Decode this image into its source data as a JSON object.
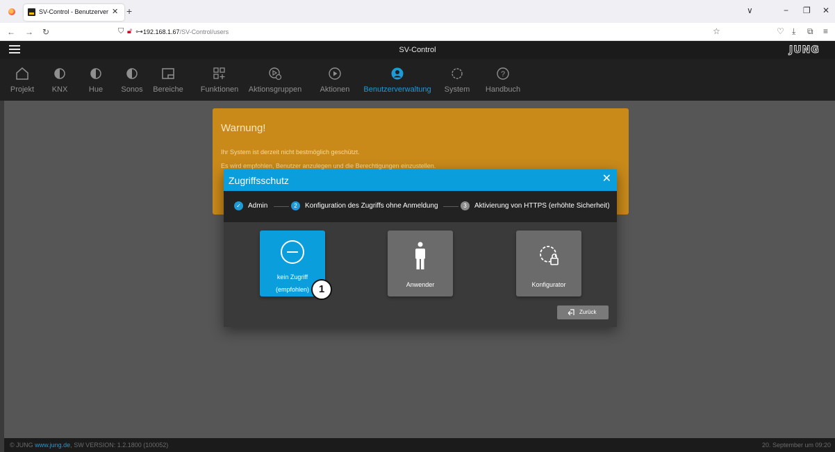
{
  "browser": {
    "tab_title": "SV-Control - Benutzerverwaltun",
    "tab_close": "✕",
    "new_tab": "+",
    "url_host": "192.168.1.67",
    "url_path": "/SV-Control/users",
    "window_controls": [
      "∨",
      "−",
      "❐",
      "✕"
    ]
  },
  "app": {
    "title": "SV-Control",
    "logo_text": "JUNG"
  },
  "nav": {
    "items": [
      {
        "label": "Projekt",
        "icon": "house-icon"
      },
      {
        "label": "KNX",
        "icon": "half-circle-icon"
      },
      {
        "label": "Hue",
        "icon": "half-circle-icon"
      },
      {
        "label": "Sonos",
        "icon": "half-circle-icon"
      },
      {
        "label": "Bereiche",
        "icon": "area-icon"
      },
      {
        "label": "Funktionen",
        "icon": "grid-plus-icon"
      },
      {
        "label": "Aktionsgruppen",
        "icon": "play-group-icon"
      },
      {
        "label": "Aktionen",
        "icon": "play-circle-icon"
      },
      {
        "label": "Benutzerverwaltung",
        "icon": "user-circle-icon",
        "active": true
      },
      {
        "label": "System",
        "icon": "gear-icon"
      },
      {
        "label": "Handbuch",
        "icon": "help-icon"
      }
    ]
  },
  "warning": {
    "title": "Warnung!",
    "line1": "Ihr System ist derzeit nicht bestmöglich geschützt.",
    "line2": "Es wird empfohlen, Benutzer anzulegen und die Berechtigungen einzustellen."
  },
  "modal": {
    "title": "Zugriffsschutz",
    "close": "✕",
    "steps": [
      {
        "number": "✓",
        "label": "Admin",
        "state": "done"
      },
      {
        "number": "2",
        "label": "Konfiguration des Zugriffs ohne Anmeldung",
        "state": "active"
      },
      {
        "number": "3",
        "label": "Aktivierung von HTTPS (erhöhte Sicherheit)",
        "state": "pending"
      }
    ],
    "options": [
      {
        "label_line1": "kein Zugriff",
        "label_line2": "(empfohlen)",
        "selected": true
      },
      {
        "label_line1": "Anwender"
      },
      {
        "label_line1": "Konfigurator"
      }
    ],
    "back_label": "Zurück"
  },
  "callout": "1",
  "footer": {
    "copyright": "© JUNG",
    "link": "www.jung.de",
    "version": ", SW VERSION: 1.2.1800 (100052)",
    "date": "20. September um 09:20"
  },
  "colors": {
    "accent": "#0a9fdc",
    "warning": "#c98a1a",
    "active_nav": "#1e9ad6"
  }
}
